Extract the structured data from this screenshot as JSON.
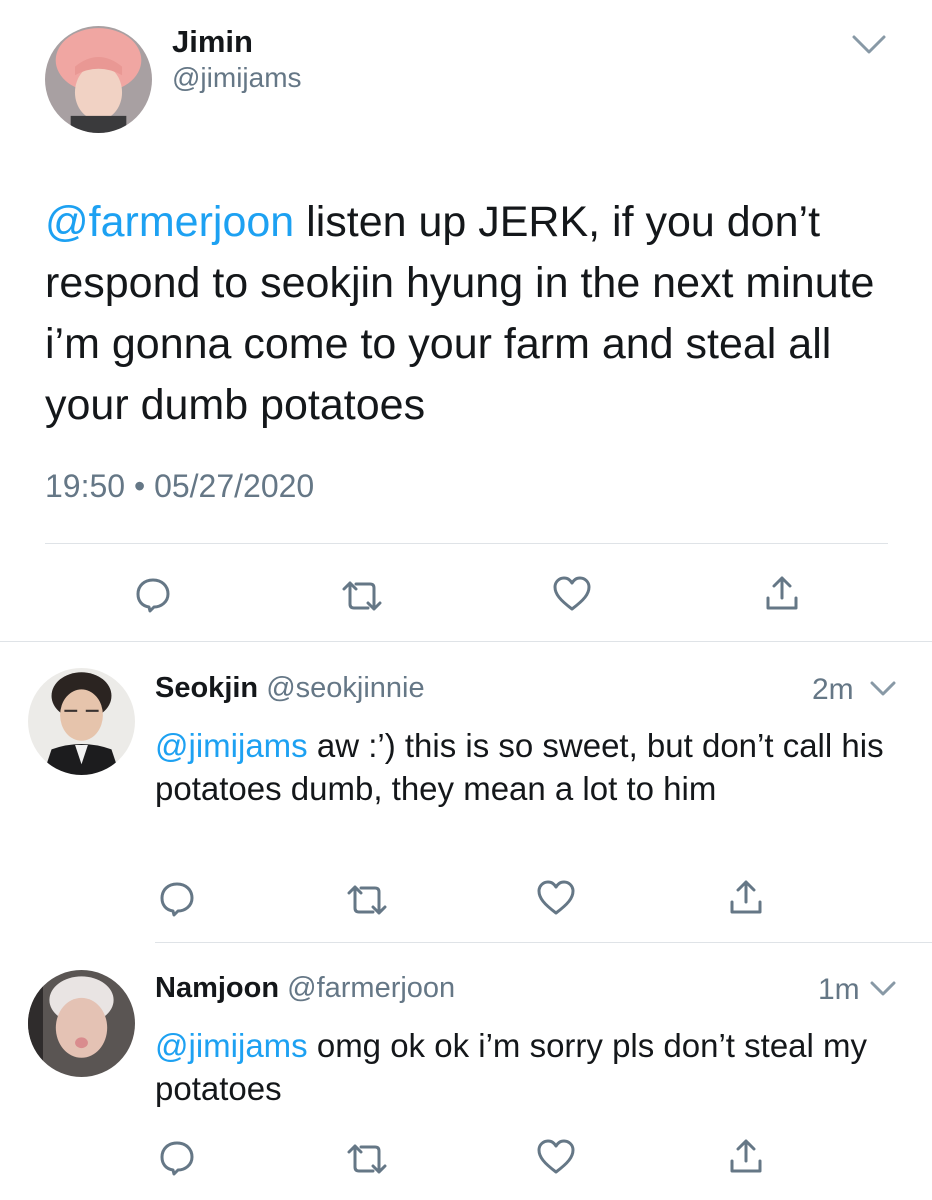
{
  "main_tweet": {
    "display_name": "Jimin",
    "handle": "@jimijams",
    "mention": "@farmerjoon",
    "text": " listen up JERK, if you don’t respond to seokjin hyung in the next minute i’m gonna come to your farm and steal all your dumb potatoes",
    "time": "19:50",
    "separator": "•",
    "date": "05/27/2020"
  },
  "replies": [
    {
      "display_name": "Seokjin",
      "handle": "@seokjinnie",
      "time_ago": "2m",
      "mention": "@jimijams",
      "text": " aw :’) this is so sweet, but don’t call his potatoes dumb, they mean a lot to him"
    },
    {
      "display_name": "Namjoon",
      "handle": "@farmerjoon",
      "time_ago": "1m",
      "mention": "@jimijams",
      "text": " omg ok ok i’m sorry pls don’t steal my potatoes"
    }
  ],
  "actions": [
    "reply-icon",
    "retweet-icon",
    "like-icon",
    "share-icon"
  ],
  "colors": {
    "link": "#1da1f2",
    "secondary": "#657786",
    "icon": "#657786",
    "divider": "#dfe3e7"
  }
}
